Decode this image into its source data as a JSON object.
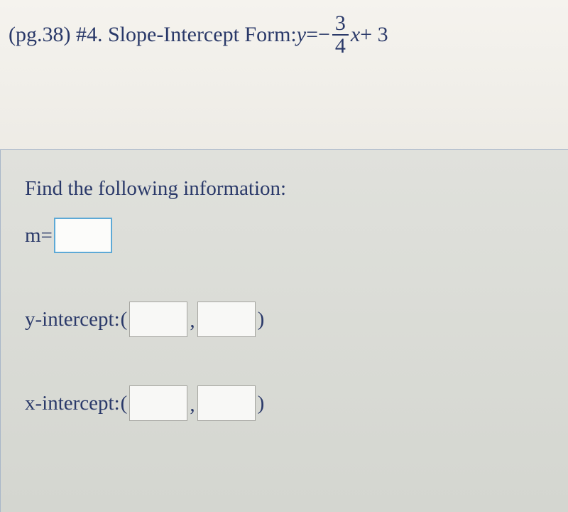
{
  "header": {
    "prefix": "(pg.38) #4. Slope-Intercept Form: ",
    "equation": {
      "lhs_var": "y",
      "equals": " = ",
      "minus": "−",
      "frac_num": "3",
      "frac_den": "4",
      "x_var": "x",
      "plus_const": " + 3"
    }
  },
  "panel": {
    "instruction": "Find the following information:",
    "slope_label": "m=",
    "y_intercept_label": "y-intercept: ",
    "x_intercept_label": "x-intercept: ",
    "open_paren": "(",
    "close_paren": ")",
    "comma": ","
  }
}
